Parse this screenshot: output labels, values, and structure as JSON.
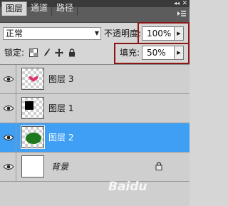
{
  "window": {
    "collapse_label": "◂◂",
    "close_label": "✕"
  },
  "tabs": [
    {
      "label": "图层",
      "active": true
    },
    {
      "label": "通道",
      "active": false
    },
    {
      "label": "路径",
      "active": false
    }
  ],
  "panel_menu_icon": "panel-menu-icon",
  "blend_mode": {
    "value": "正常",
    "arrow": "▼"
  },
  "opacity": {
    "label": "不透明度:",
    "value": "100%",
    "arrow": "▶"
  },
  "lock": {
    "label": "锁定:"
  },
  "fill": {
    "label": "填充:",
    "value": "50%",
    "arrow": "▶"
  },
  "layers": [
    {
      "name": "图层 3",
      "thumb": "pink-heart",
      "visible": true,
      "selected": false
    },
    {
      "name": "图层 1",
      "thumb": "black-square",
      "visible": true,
      "selected": false
    },
    {
      "name": "图层 2",
      "thumb": "green-ellipse",
      "visible": true,
      "selected": true
    },
    {
      "name": "背景",
      "thumb": "white",
      "visible": true,
      "selected": false,
      "locked": true
    }
  ],
  "colors": {
    "selection": "#3e9ff5",
    "highlight": "#8b1616",
    "heart": "#e0336a",
    "ellipse": "#1f7a1f"
  },
  "watermark": "Baidu"
}
